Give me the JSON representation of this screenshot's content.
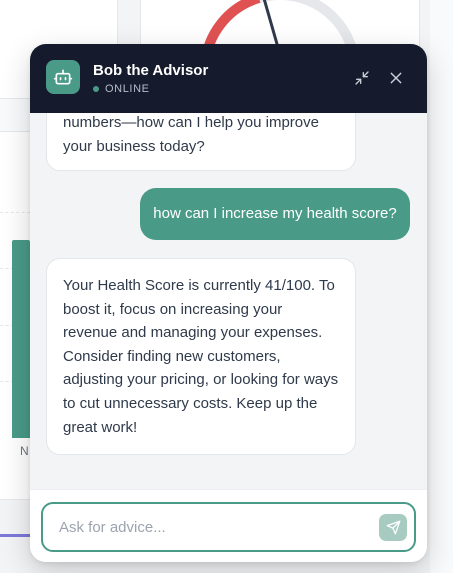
{
  "background": {
    "axis_label": "N"
  },
  "chat": {
    "header": {
      "name": "Bob the Advisor",
      "status": "ONLINE",
      "avatar_icon": "robot-icon",
      "minimize_icon": "minimize-arrows-icon",
      "close_icon": "close-icon"
    },
    "messages": [
      {
        "role": "bot",
        "text": "numbers—how can I help you improve your business today?"
      },
      {
        "role": "user",
        "text": "how can I increase my health score?"
      },
      {
        "role": "bot",
        "text": "Your Health Score is currently 41/100. To boost it, focus on increasing your revenue and managing your expenses. Consider finding new customers, adjusting your pricing, or looking for ways to cut unnecessary costs. Keep up the great work!"
      }
    ],
    "input": {
      "placeholder": "Ask for advice...",
      "value": ""
    },
    "send_icon": "send-icon"
  },
  "colors": {
    "accent": "#4a9a88",
    "header_bg": "#151b2c",
    "chat_bg": "#f3f4f6",
    "gauge_red": "#e05252"
  }
}
